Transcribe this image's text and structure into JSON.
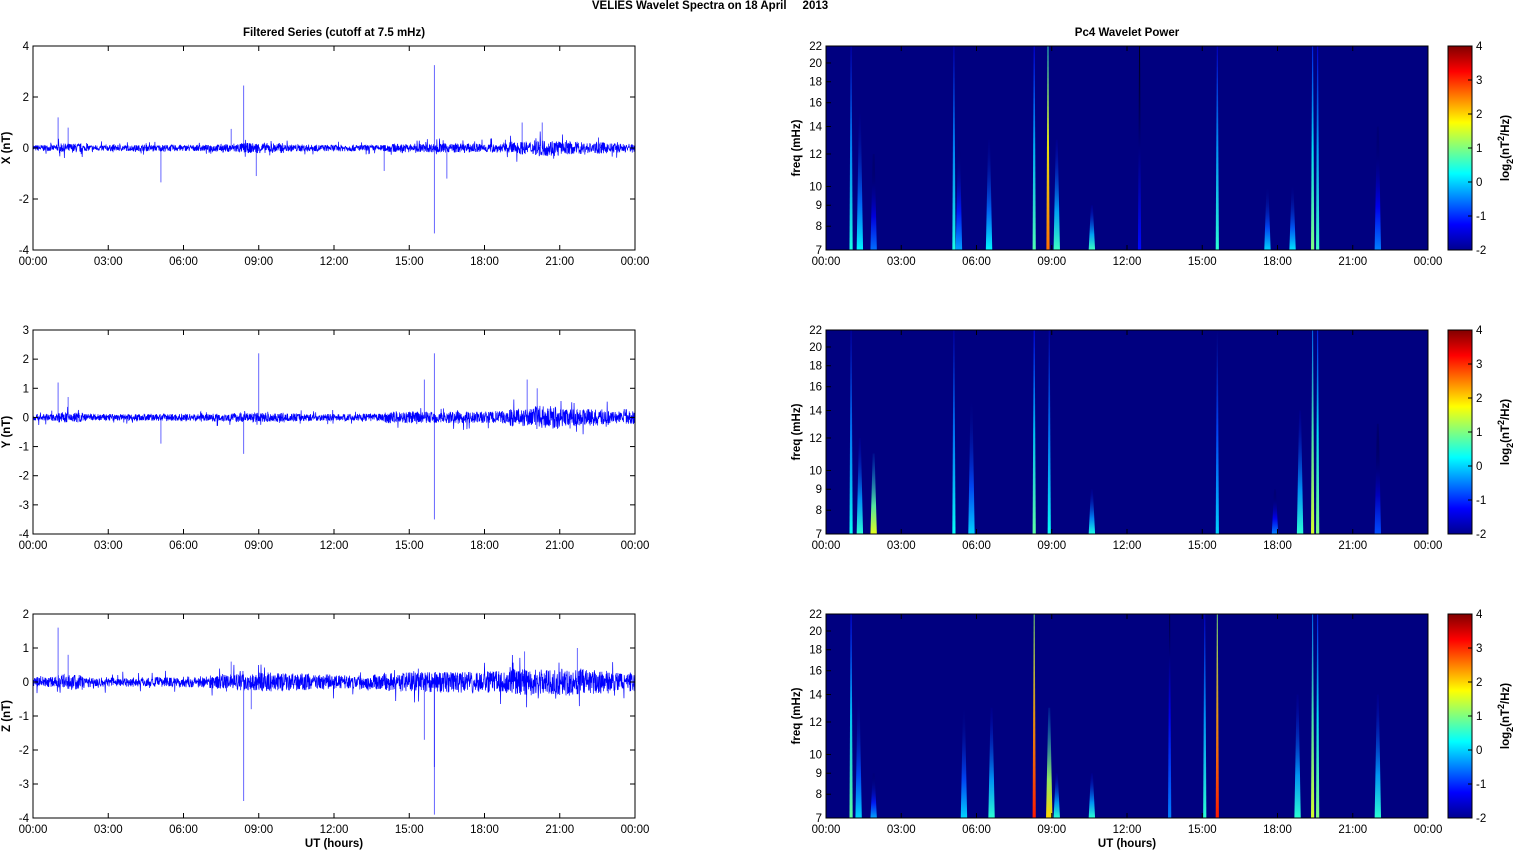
{
  "figure_title": "VELIES Wavelet Spectra on 18 April     2013",
  "left_title": "Filtered Series (cutoff at 7.5 mHz)",
  "right_title": "Pc4 Wavelet Power",
  "x_label": "UT (hours)",
  "freq_label": "freq (mHz)",
  "colorbar_label": "log2(nT2/Hz)",
  "colorbar_label_parts": {
    "base": "log",
    "sub": "2",
    "open": "(nT",
    "sup": "2",
    "close": "/Hz)"
  },
  "chart_data": [
    {
      "type": "line",
      "name": "X",
      "ylabel": "X (nT)",
      "ylim": [
        -4,
        4
      ],
      "yticks": [
        "-4",
        "-2",
        "0",
        "2",
        "4"
      ],
      "ytick_values": [
        -4,
        -2,
        0,
        2,
        4
      ],
      "xlim": [
        0,
        24
      ],
      "xticks": [
        "00:00",
        "03:00",
        "06:00",
        "09:00",
        "12:00",
        "15:00",
        "18:00",
        "21:00",
        "00:00"
      ],
      "noise_envelope_nT": [
        0.12,
        0.18,
        0.12,
        0.12,
        0.12,
        0.13,
        0.12,
        0.15,
        0.2,
        0.2,
        0.14,
        0.13,
        0.13,
        0.12,
        0.16,
        0.17,
        0.18,
        0.18,
        0.18,
        0.25,
        0.32,
        0.25,
        0.22,
        0.18
      ],
      "spikes": [
        [
          1.0,
          1.2
        ],
        [
          1.4,
          0.8
        ],
        [
          5.1,
          -1.35
        ],
        [
          7.9,
          0.75
        ],
        [
          8.4,
          2.45
        ],
        [
          8.9,
          -1.1
        ],
        [
          14.0,
          -0.9
        ],
        [
          16.0,
          3.25
        ],
        [
          16.0,
          -3.35
        ],
        [
          16.5,
          -1.2
        ],
        [
          19.5,
          1.0
        ],
        [
          20.3,
          1.0
        ]
      ]
    },
    {
      "type": "line",
      "name": "Y",
      "ylabel": "Y (nT)",
      "ylim": [
        -4,
        3
      ],
      "yticks": [
        "-4",
        "-3",
        "-2",
        "-1",
        "0",
        "1",
        "2",
        "3"
      ],
      "ytick_values": [
        -4,
        -3,
        -2,
        -1,
        0,
        1,
        2,
        3
      ],
      "xlim": [
        0,
        24
      ],
      "xticks": [
        "00:00",
        "03:00",
        "06:00",
        "09:00",
        "12:00",
        "15:00",
        "18:00",
        "21:00",
        "00:00"
      ],
      "noise_envelope_nT": [
        0.12,
        0.18,
        0.12,
        0.12,
        0.12,
        0.13,
        0.12,
        0.14,
        0.16,
        0.16,
        0.13,
        0.12,
        0.12,
        0.13,
        0.2,
        0.2,
        0.2,
        0.2,
        0.22,
        0.3,
        0.4,
        0.3,
        0.28,
        0.22
      ],
      "spikes": [
        [
          1.0,
          1.2
        ],
        [
          1.4,
          0.7
        ],
        [
          5.1,
          -0.9
        ],
        [
          8.4,
          -1.25
        ],
        [
          9.0,
          2.2
        ],
        [
          15.6,
          1.3
        ],
        [
          16.0,
          2.2
        ],
        [
          16.0,
          -3.5
        ],
        [
          19.7,
          1.3
        ],
        [
          20.1,
          1.0
        ]
      ]
    },
    {
      "type": "line",
      "name": "Z",
      "ylabel": "Z (nT)",
      "ylim": [
        -4,
        2
      ],
      "yticks": [
        "-4",
        "-3",
        "-2",
        "-1",
        "0",
        "1",
        "2"
      ],
      "ytick_values": [
        -4,
        -3,
        -2,
        -1,
        0,
        1,
        2
      ],
      "xlim": [
        0,
        24
      ],
      "xticks": [
        "00:00",
        "03:00",
        "06:00",
        "09:00",
        "12:00",
        "15:00",
        "18:00",
        "21:00",
        "00:00"
      ],
      "noise_envelope_nT": [
        0.15,
        0.22,
        0.15,
        0.14,
        0.14,
        0.15,
        0.16,
        0.2,
        0.25,
        0.28,
        0.25,
        0.22,
        0.2,
        0.22,
        0.28,
        0.3,
        0.3,
        0.3,
        0.33,
        0.4,
        0.38,
        0.4,
        0.35,
        0.28
      ],
      "spikes": [
        [
          1.0,
          1.6
        ],
        [
          1.4,
          0.8
        ],
        [
          7.9,
          0.6
        ],
        [
          8.4,
          -3.5
        ],
        [
          8.7,
          -0.8
        ],
        [
          15.6,
          -1.7
        ],
        [
          16.0,
          -3.9
        ],
        [
          16.0,
          -2.5
        ],
        [
          19.6,
          0.9
        ],
        [
          21.7,
          1.0
        ]
      ]
    },
    {
      "type": "heatmap",
      "name": "X spectrum",
      "ylabel": "freq (mHz)",
      "ylim": [
        7,
        22
      ],
      "yscale": "log",
      "yticks": [
        "7",
        "8",
        "9",
        "10",
        "12",
        "14",
        "16",
        "18",
        "20",
        "22"
      ],
      "ytick_values": [
        7,
        8,
        9,
        10,
        12,
        14,
        16,
        18,
        20,
        22
      ],
      "xlim": [
        0,
        24
      ],
      "xticks": [
        "00:00",
        "03:00",
        "06:00",
        "09:00",
        "12:00",
        "15:00",
        "18:00",
        "21:00",
        "00:00"
      ],
      "clim": [
        -2,
        4
      ],
      "cticks": [
        "-2",
        "-1",
        "0",
        "1",
        "2",
        "3",
        "4"
      ],
      "ctick_values": [
        -2,
        -1,
        0,
        1,
        2,
        3,
        4
      ],
      "background_level": -2,
      "features": [
        [
          1.0,
          22,
          0.4
        ],
        [
          1.35,
          15,
          0.2
        ],
        [
          1.9,
          12,
          -0.6
        ],
        [
          5.1,
          22,
          0.4
        ],
        [
          5.3,
          13,
          -0.3
        ],
        [
          6.5,
          13,
          0.2
        ],
        [
          8.3,
          22,
          0.7
        ],
        [
          8.85,
          22,
          2.6
        ],
        [
          9.2,
          13,
          0.6
        ],
        [
          10.6,
          9,
          0.6
        ],
        [
          12.5,
          22,
          -1.2
        ],
        [
          15.6,
          22,
          0.5
        ],
        [
          17.6,
          10,
          0
        ],
        [
          18.6,
          10,
          0.1
        ],
        [
          19.4,
          22,
          1.0
        ],
        [
          19.6,
          22,
          0.6
        ],
        [
          22.0,
          14,
          -0.5
        ]
      ]
    },
    {
      "type": "heatmap",
      "name": "Y spectrum",
      "ylabel": "freq (mHz)",
      "ylim": [
        7,
        22
      ],
      "yscale": "log",
      "yticks": [
        "7",
        "8",
        "9",
        "10",
        "12",
        "14",
        "16",
        "18",
        "20",
        "22"
      ],
      "ytick_values": [
        7,
        8,
        9,
        10,
        12,
        14,
        16,
        18,
        20,
        22
      ],
      "xlim": [
        0,
        24
      ],
      "xticks": [
        "00:00",
        "03:00",
        "06:00",
        "09:00",
        "12:00",
        "15:00",
        "18:00",
        "21:00",
        "00:00"
      ],
      "clim": [
        -2,
        4
      ],
      "cticks": [
        "-2",
        "-1",
        "0",
        "1",
        "2",
        "3",
        "4"
      ],
      "ctick_values": [
        -2,
        -1,
        0,
        1,
        2,
        3,
        4
      ],
      "background_level": -2,
      "features": [
        [
          1.0,
          22,
          0.3
        ],
        [
          1.35,
          12,
          0.5
        ],
        [
          1.9,
          11,
          1.6
        ],
        [
          5.1,
          22,
          0.3
        ],
        [
          5.8,
          15,
          0
        ],
        [
          8.3,
          22,
          0.8
        ],
        [
          8.9,
          22,
          0.3
        ],
        [
          10.6,
          9,
          0.4
        ],
        [
          15.6,
          22,
          0
        ],
        [
          17.9,
          9,
          -0.5
        ],
        [
          18.9,
          14,
          0.5
        ],
        [
          19.4,
          22,
          1.5
        ],
        [
          19.6,
          22,
          1.0
        ],
        [
          22.0,
          13,
          -0.8
        ]
      ]
    },
    {
      "type": "heatmap",
      "name": "Z spectrum",
      "ylabel": "freq (mHz)",
      "ylim": [
        7,
        22
      ],
      "yscale": "log",
      "yticks": [
        "7",
        "8",
        "9",
        "10",
        "12",
        "14",
        "16",
        "18",
        "20",
        "22"
      ],
      "ytick_values": [
        7,
        8,
        9,
        10,
        12,
        14,
        16,
        18,
        20,
        22
      ],
      "xlim": [
        0,
        24
      ],
      "xticks": [
        "00:00",
        "03:00",
        "06:00",
        "09:00",
        "12:00",
        "15:00",
        "18:00",
        "21:00",
        "00:00"
      ],
      "clim": [
        -2,
        4
      ],
      "cticks": [
        "-2",
        "-1",
        "0",
        "1",
        "2",
        "3",
        "4"
      ],
      "ctick_values": [
        -2,
        -1,
        0,
        1,
        2,
        3,
        4
      ],
      "background_level": -2,
      "features": [
        [
          1.0,
          22,
          0.8
        ],
        [
          1.3,
          14,
          0
        ],
        [
          1.9,
          9,
          -0.3
        ],
        [
          5.5,
          13,
          0
        ],
        [
          6.6,
          13,
          0.5
        ],
        [
          8.3,
          22,
          3.1
        ],
        [
          8.9,
          13,
          2.0
        ],
        [
          9.2,
          9,
          0.5
        ],
        [
          10.6,
          9,
          0.5
        ],
        [
          13.7,
          22,
          -0.5
        ],
        [
          15.1,
          22,
          0.5
        ],
        [
          15.6,
          22,
          3.1
        ],
        [
          18.8,
          14,
          0.5
        ],
        [
          19.4,
          22,
          1.5
        ],
        [
          19.6,
          22,
          1.0
        ],
        [
          22.0,
          14,
          0.5
        ]
      ]
    }
  ]
}
